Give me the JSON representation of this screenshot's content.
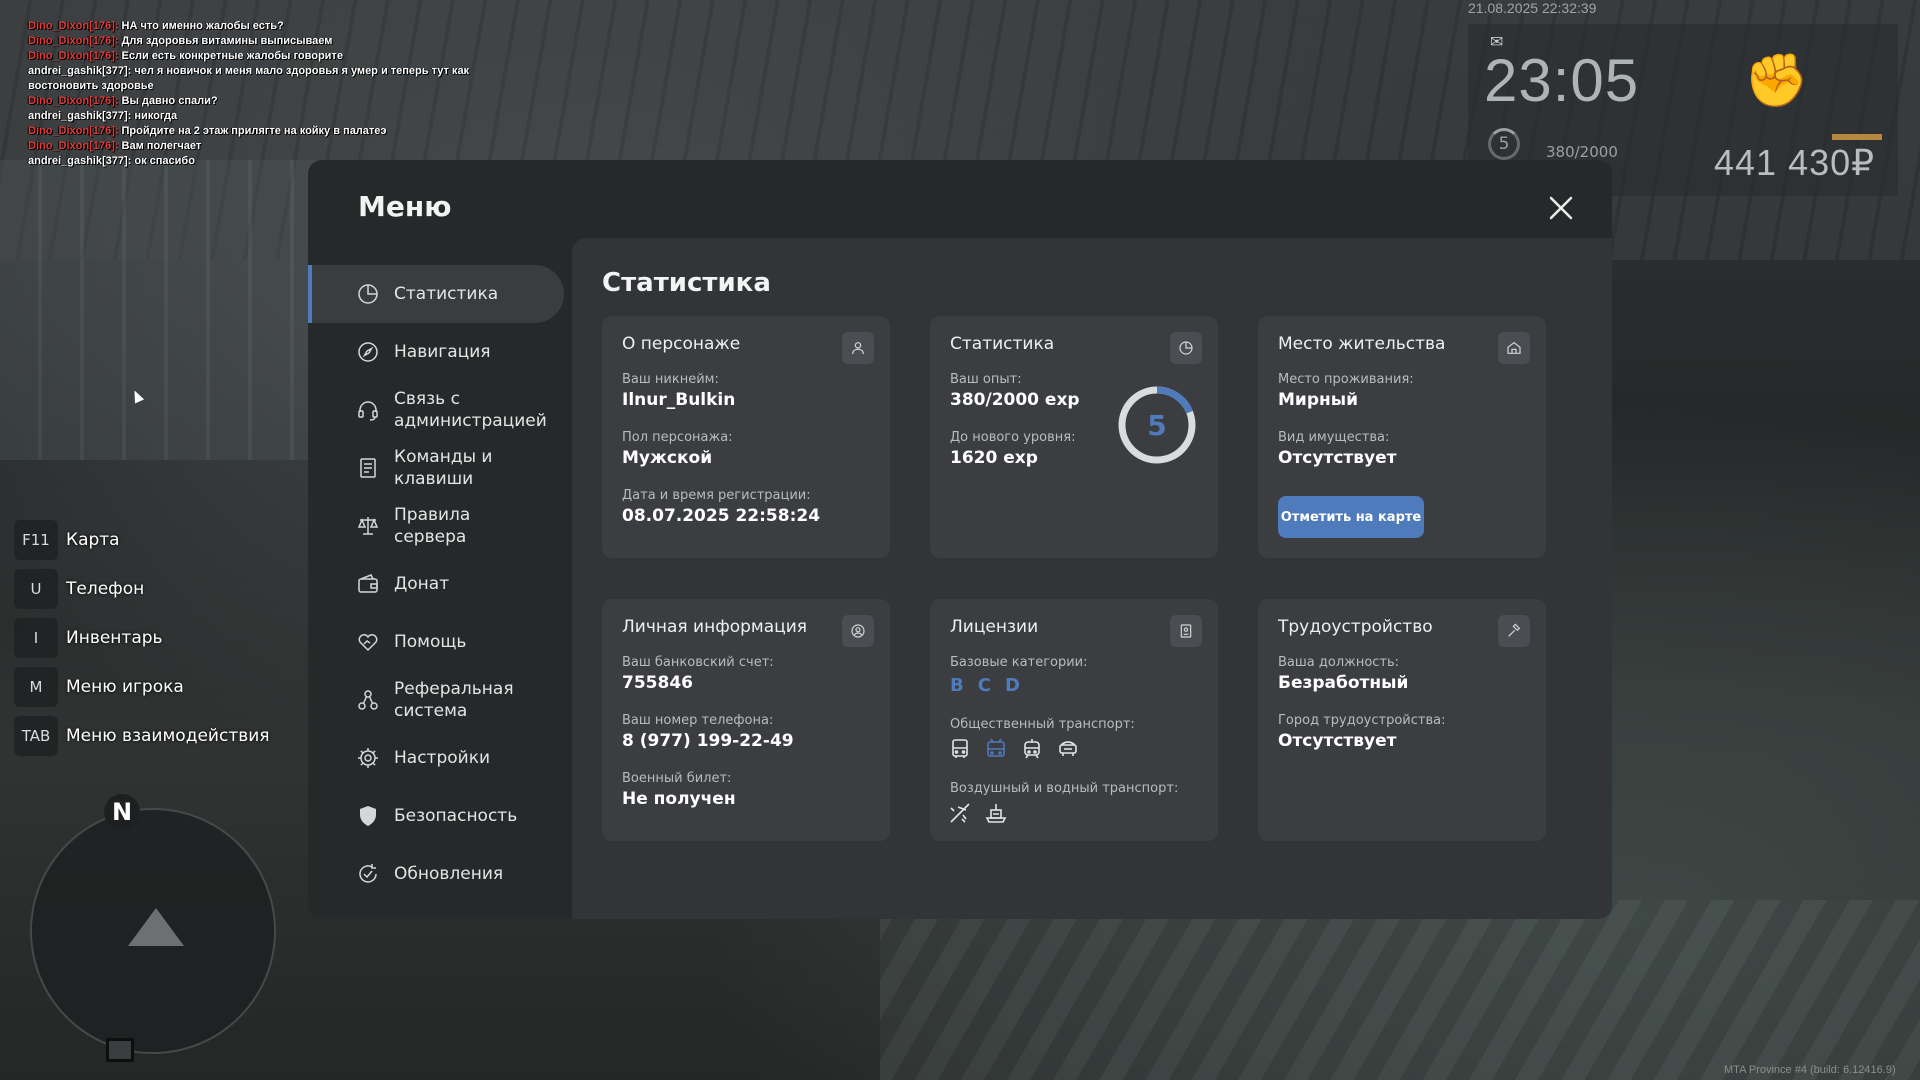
{
  "chat": [
    {
      "name": "Dino_Dixon[176]:",
      "name_color": "red",
      "text": " НА что именно жалобы есть?"
    },
    {
      "name": "Dino_Dixon[176]:",
      "name_color": "red",
      "text": " Для здоровья витамины выписываем"
    },
    {
      "name": "Dino_Dixon[176]:",
      "name_color": "red",
      "text": " Если есть конкретные жалобы говорите"
    },
    {
      "name": "",
      "name_color": "white",
      "text": "andrei_gashik[377]: чел я новичок и меня мало здоровья я умер и теперь тут как"
    },
    {
      "name": "",
      "name_color": "white",
      "text": " востоновить здоровье"
    },
    {
      "name": "Dino_Dixon[176]:",
      "name_color": "red",
      "text": " Вы давно спали?"
    },
    {
      "name": "",
      "name_color": "white",
      "text": "andrei_gashik[377]: никогда"
    },
    {
      "name": "Dino_Dixon[176]:",
      "name_color": "red",
      "text": " Пройдите на 2 этаж прилягте на койку в палатеэ"
    },
    {
      "name": "Dino_Dixon[176]:",
      "name_color": "red",
      "text": " Вам полегчает"
    },
    {
      "name": "",
      "name_color": "white",
      "text": "andrei_gashik[377]: ок спасибо"
    }
  ],
  "hud": {
    "datetime": "21.08.2025 22:32:39",
    "time": "23:05",
    "level": "5",
    "exp": "380/2000",
    "money": "441 430₽",
    "mail_icon": "mail-icon",
    "fist_icon": "fist-icon"
  },
  "keybinds": [
    {
      "key": "F11",
      "label": "Карта"
    },
    {
      "key": "U",
      "label": "Телефон"
    },
    {
      "key": "I",
      "label": "Инвентарь"
    },
    {
      "key": "M",
      "label": "Меню игрока"
    },
    {
      "key": "TAB",
      "label": "Меню взаимодействия"
    }
  ],
  "radar": {
    "north": "N"
  },
  "menu": {
    "title": "Меню",
    "sidebar": [
      {
        "label": "Статистика",
        "icon": "pie-chart-icon",
        "active": true
      },
      {
        "label": "Навигация",
        "icon": "compass-icon"
      },
      {
        "label": "Связь с администрацией",
        "icon": "headset-icon"
      },
      {
        "label": "Команды и клавиши",
        "icon": "document-icon"
      },
      {
        "label": "Правила сервера",
        "icon": "scales-icon"
      },
      {
        "label": "Донат",
        "icon": "wallet-icon"
      },
      {
        "label": "Помощь",
        "icon": "heart-hand-icon"
      },
      {
        "label": "Реферальная система",
        "icon": "referral-icon"
      },
      {
        "label": "Настройки",
        "icon": "gear-icon"
      },
      {
        "label": "Безопасность",
        "icon": "shield-icon"
      },
      {
        "label": "Обновления",
        "icon": "refresh-check-icon"
      }
    ],
    "content_title": "Статистика",
    "cards": {
      "character": {
        "title": "О персонаже",
        "nickname_label": "Ваш никнейм:",
        "nickname": "Ilnur_Bulkin",
        "gender_label": "Пол персонажа:",
        "gender": "Мужской",
        "reg_label": "Дата и время регистрации:",
        "reg": "08.07.2025 22:58:24"
      },
      "stats": {
        "title": "Статистика",
        "exp_label": "Ваш опыт:",
        "exp": "380/2000 exp",
        "next_label": "До нового уровня:",
        "next": "1620 exp",
        "level": "5",
        "level_progress": 0.19
      },
      "residence": {
        "title": "Место жительства",
        "place_label": "Место проживания:",
        "place": "Мирный",
        "property_label": "Вид имущества:",
        "property": "Отсутствует",
        "map_button": "Отметить на карте"
      },
      "personal": {
        "title": "Личная информация",
        "bank_label": "Ваш банковский счет:",
        "bank": "755846",
        "phone_label": "Ваш номер телефона:",
        "phone": "8 (977) 199-22-49",
        "military_label": "Военный билет:",
        "military": "Не получен"
      },
      "licenses": {
        "title": "Лицензии",
        "base_label": "Базовые категории:",
        "categories": [
          "B",
          "C",
          "D"
        ],
        "public_label": "Общественный транспорт:",
        "air_water_label": "Воздушный и водный транспорт:"
      },
      "employment": {
        "title": "Трудоустройство",
        "position_label": "Ваша должность:",
        "position": "Безработный",
        "city_label": "Город трудоустройства:",
        "city": "Отсутствует"
      }
    }
  },
  "build": "MTA Province #4 (build: 6.12416.9)",
  "colors": {
    "accent": "#4f7bbd",
    "chat_red": "#e23b3b"
  }
}
